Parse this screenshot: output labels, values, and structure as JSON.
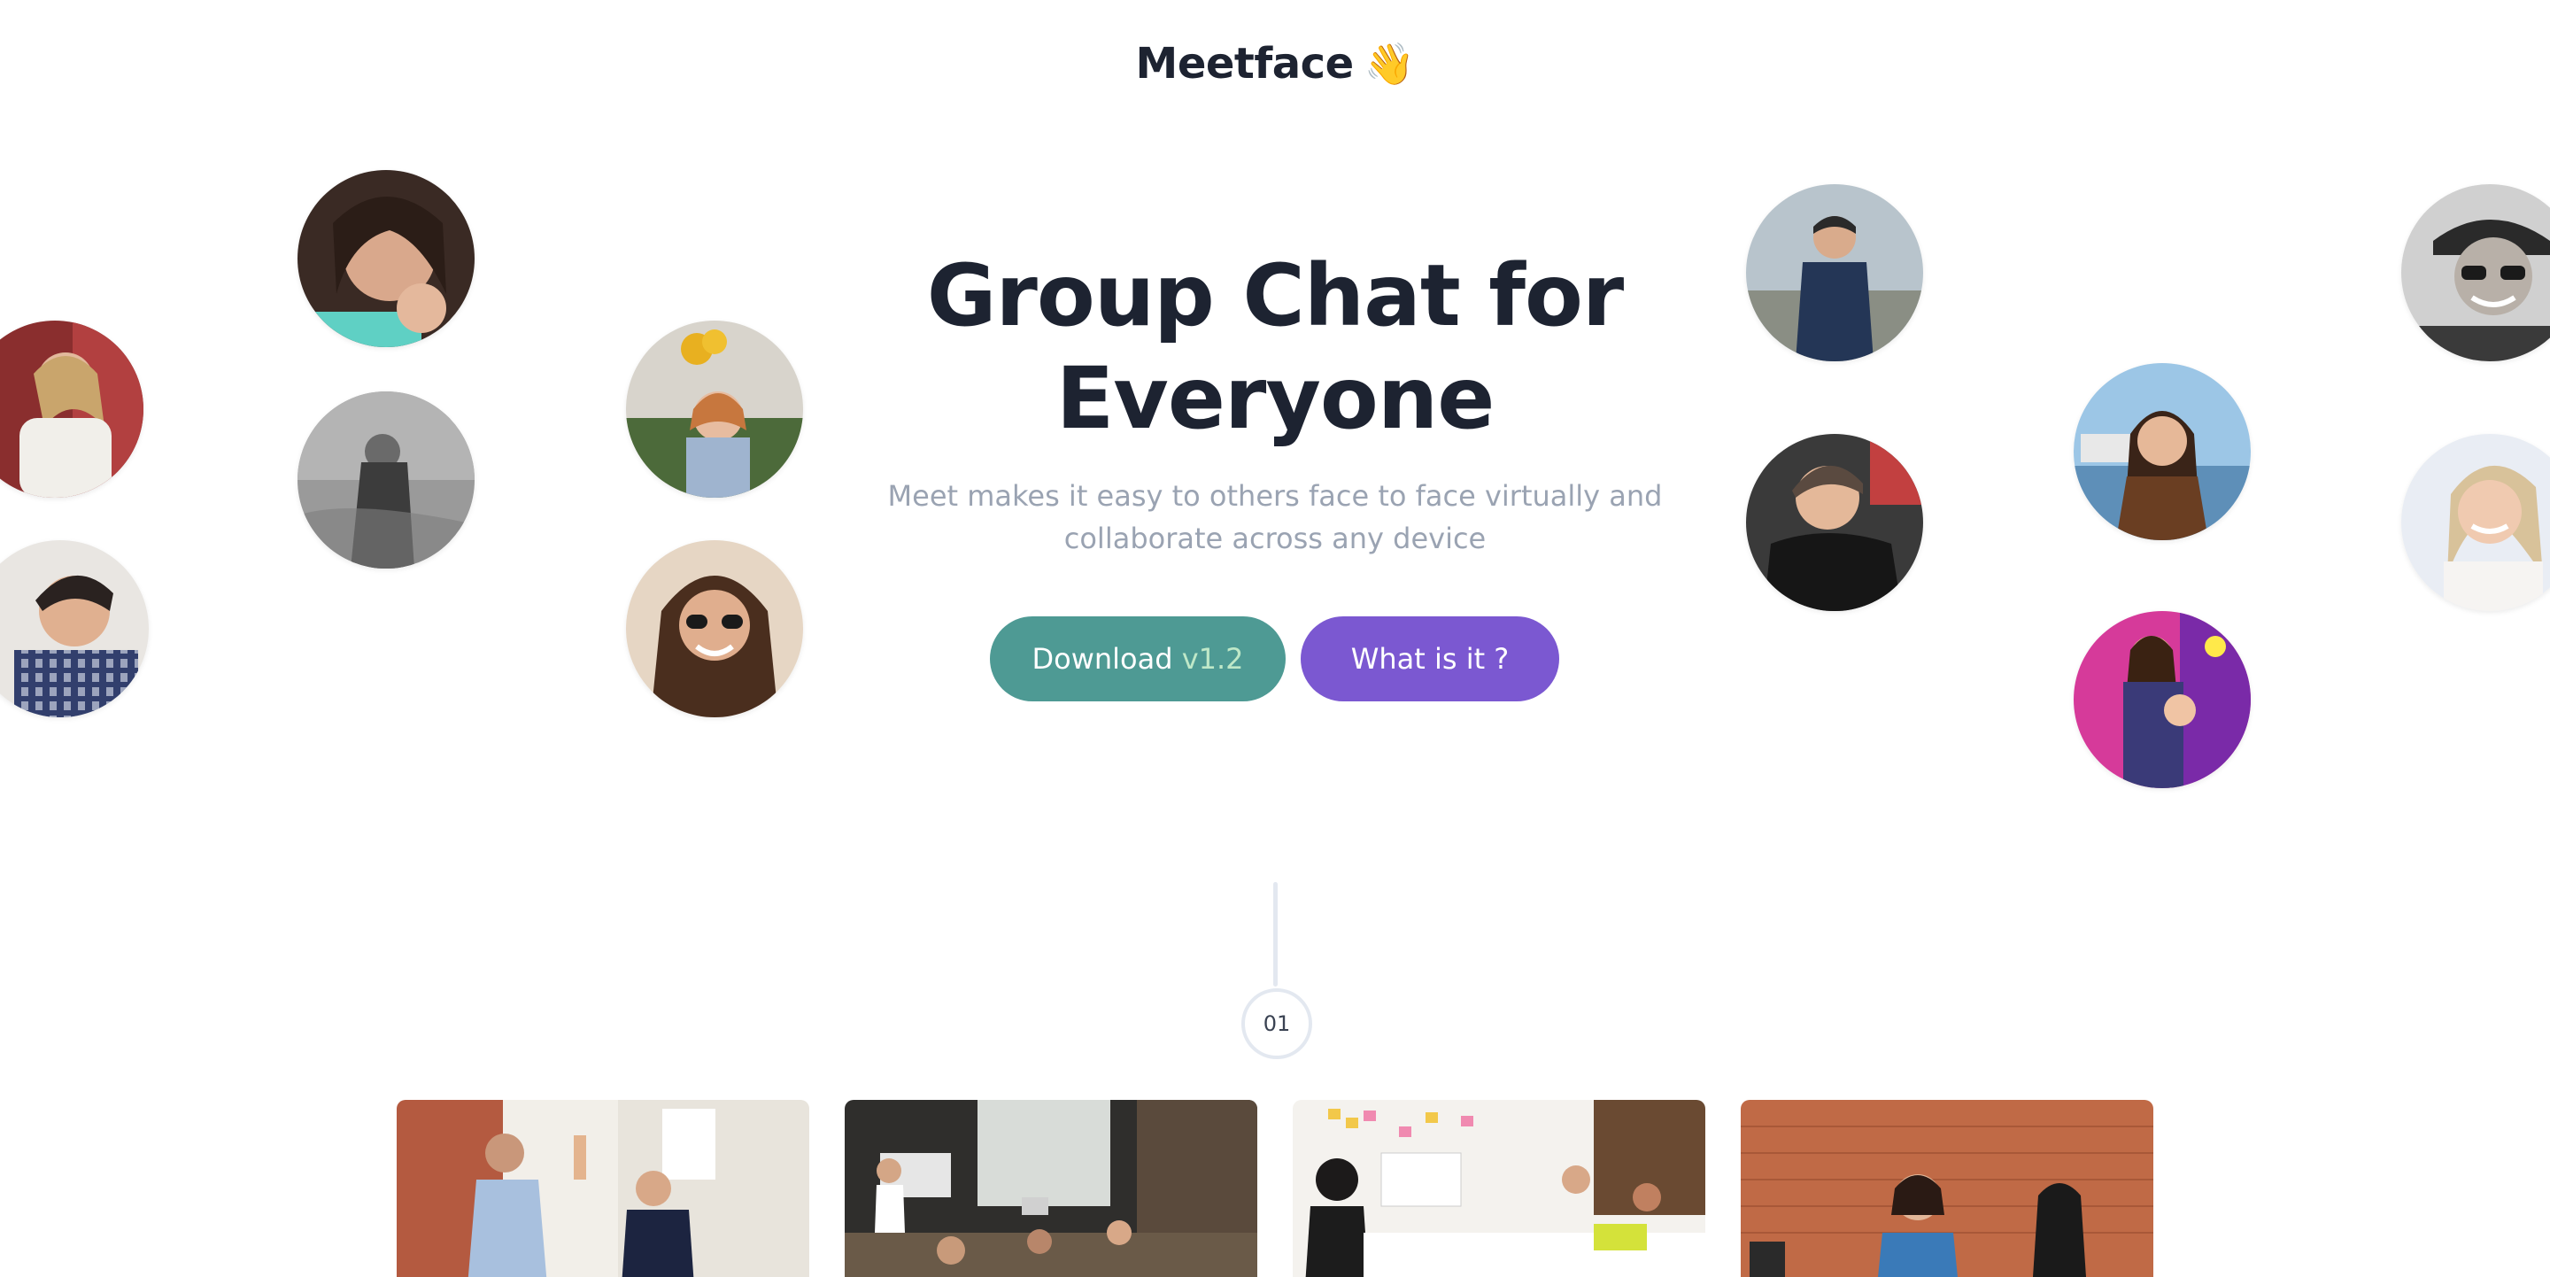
{
  "brand": {
    "name": "Meetface",
    "emoji": "👋"
  },
  "hero": {
    "title_line1": "Group Chat for",
    "title_line2": "Everyone",
    "subtitle_line1": "Meet makes it easy to others face to face virtually and",
    "subtitle_line2": "collaborate across any device"
  },
  "buttons": {
    "download_label": "Download",
    "download_version": "v1.2",
    "what_label": "What is it ?"
  },
  "timeline": {
    "step_number": "01"
  },
  "colors": {
    "download_button": "#4e9a94",
    "what_button": "#7b58d1",
    "title_text": "#1d2331",
    "subtitle_text": "#9aa3b2"
  }
}
